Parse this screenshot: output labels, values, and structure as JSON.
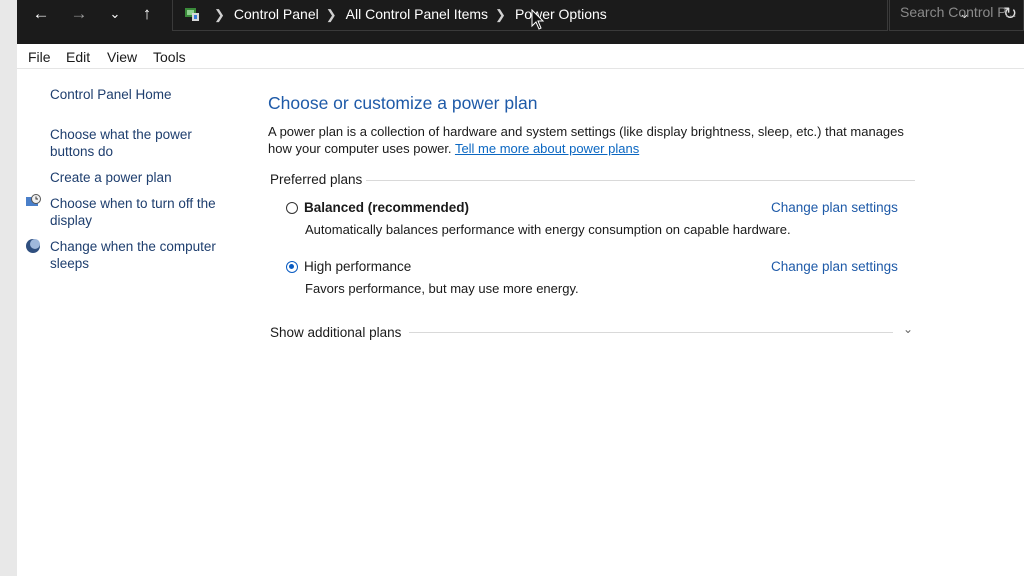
{
  "nav": {
    "back_icon": "arrow-left-icon",
    "forward_icon": "arrow-right-icon",
    "recent_icon": "chevron-down-icon",
    "up_icon": "arrow-up-icon"
  },
  "address": {
    "crumbs": [
      "Control Panel",
      "All Control Panel Items",
      "Power Options"
    ],
    "search_placeholder": "Search Control P..."
  },
  "menu": [
    "File",
    "Edit",
    "View",
    "Tools"
  ],
  "sidebar": {
    "home": "Control Panel Home",
    "links": [
      "Choose what the power buttons do",
      "Create a power plan",
      "Choose when to turn off the display",
      "Change when the computer sleeps"
    ]
  },
  "main": {
    "title": "Choose or customize a power plan",
    "description": "A power plan is a collection of hardware and system settings (like display brightness, sleep, etc.) that manages how your computer uses power.",
    "learn_link": "Tell me more about power plans",
    "preferred_label": "Preferred plans",
    "plans": [
      {
        "name": "Balanced (recommended)",
        "description": "Automatically balances performance with energy consumption on capable hardware.",
        "selected": false,
        "link": "Change plan settings"
      },
      {
        "name": "High performance",
        "description": "Favors performance, but may use more energy.",
        "selected": true,
        "link": "Change plan settings"
      }
    ],
    "additional_label": "Show additional plans"
  },
  "colors": {
    "title_blue": "#1e5aa8",
    "link_blue": "#0b67c2",
    "address_bg": "#1b1b1b"
  }
}
